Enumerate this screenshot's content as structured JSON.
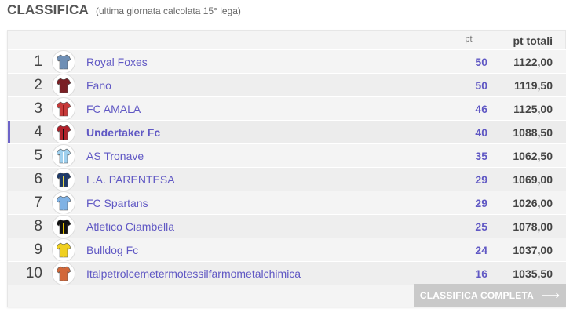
{
  "header": {
    "title": "CLASSIFICA",
    "subtitle": "(ultima giornata calcolata 15° lega)"
  },
  "columns": {
    "pt": "pt",
    "total": "pt totali"
  },
  "teams": [
    {
      "rank": "1",
      "name": "Royal Foxes",
      "pt": "50",
      "total": "1122,00",
      "shirt": "#6f8fb5",
      "shirt2": "#6f8fb5"
    },
    {
      "rank": "2",
      "name": "Fano",
      "pt": "50",
      "total": "1119,50",
      "shirt": "#7a1f24",
      "shirt2": "#7a1f24"
    },
    {
      "rank": "3",
      "name": "FC AMALA",
      "pt": "46",
      "total": "1125,00",
      "shirt": "#c83a3a",
      "shirt2": "#8a1a1a"
    },
    {
      "rank": "4",
      "name": "Undertaker Fc",
      "pt": "40",
      "total": "1088,50",
      "shirt": "#b0202a",
      "shirt2": "#111111"
    },
    {
      "rank": "5",
      "name": "AS Tronave",
      "pt": "35",
      "total": "1062,50",
      "shirt": "#9fd0ee",
      "shirt2": "#ffffff"
    },
    {
      "rank": "6",
      "name": "L.A. PARENTESA",
      "pt": "29",
      "total": "1069,00",
      "shirt": "#1e3a6a",
      "shirt2": "#e8d84a"
    },
    {
      "rank": "7",
      "name": "FC Spartans",
      "pt": "29",
      "total": "1026,00",
      "shirt": "#7fb2e5",
      "shirt2": "#7fb2e5"
    },
    {
      "rank": "8",
      "name": "Atletico Ciambella",
      "pt": "25",
      "total": "1078,00",
      "shirt": "#111111",
      "shirt2": "#e6c200"
    },
    {
      "rank": "9",
      "name": "Bulldog Fc",
      "pt": "24",
      "total": "1037,00",
      "shirt": "#f0d020",
      "shirt2": "#f0d020"
    },
    {
      "rank": "10",
      "name": "Italpetrolcemetermotessilfarmometalchimica",
      "pt": "16",
      "total": "1035,50",
      "shirt": "#d2683a",
      "shirt2": "#d2683a"
    }
  ],
  "highlight_rank": "4",
  "full_button": {
    "label": "CLASSIFICA COMPLETA",
    "arrow": "⟶"
  }
}
